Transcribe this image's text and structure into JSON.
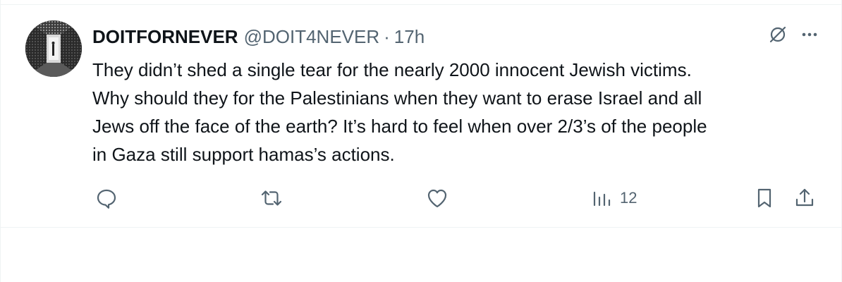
{
  "tweet": {
    "display_name": "DOITFORNEVER",
    "handle": "@DOIT4NEVER",
    "separator": "·",
    "time": "17h",
    "text_lines": [
      "They didn’t shed a single tear for the nearly 2000 innocent Jewish victims.",
      "Why should they for the Palestinians when they want to erase Israel and all",
      "Jews off the face of the earth? It’s hard to feel when over 2/3’s of the people",
      "in Gaza still support hamas’s actions."
    ]
  },
  "actions": {
    "views_count": "12"
  },
  "icons": {
    "grok": "grok-icon",
    "more": "more-icon",
    "reply": "reply-icon",
    "retweet": "retweet-icon",
    "like": "heart-icon",
    "views": "views-icon",
    "bookmark": "bookmark-icon",
    "share": "share-icon"
  },
  "colors": {
    "text": "#0f1419",
    "secondary": "#536471",
    "border": "#eff3f4"
  }
}
